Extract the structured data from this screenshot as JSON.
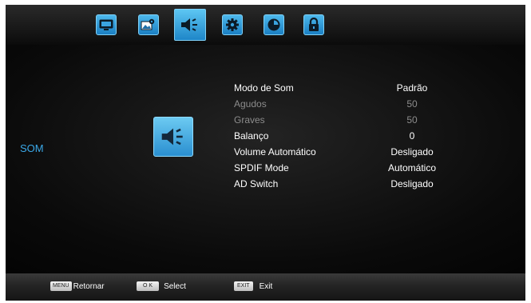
{
  "tabs": [
    {
      "icon": "tv-screen-icon",
      "active": false
    },
    {
      "icon": "picture-settings-icon",
      "active": false
    },
    {
      "icon": "speaker-icon",
      "active": true
    },
    {
      "icon": "gear-icon",
      "active": false
    },
    {
      "icon": "clock-icon",
      "active": false
    },
    {
      "icon": "lock-icon",
      "active": false
    }
  ],
  "section": {
    "title": "SOM",
    "icon": "speaker-icon"
  },
  "menu": {
    "items": [
      {
        "label": "Modo de Som",
        "value": "Padrão",
        "enabled": true
      },
      {
        "label": "Agudos",
        "value": "50",
        "enabled": false
      },
      {
        "label": "Graves",
        "value": "50",
        "enabled": false
      },
      {
        "label": "Balanço",
        "value": "0",
        "enabled": true
      },
      {
        "label": "Volume Automático",
        "value": "Desligado",
        "enabled": true
      },
      {
        "label": "SPDIF Mode",
        "value": "Automático",
        "enabled": true
      },
      {
        "label": "AD Switch",
        "value": "Desligado",
        "enabled": true
      }
    ]
  },
  "footer": {
    "hints": [
      {
        "key": "MENU",
        "text": "Retornar"
      },
      {
        "key": "O K",
        "text": "Select"
      },
      {
        "key": "EXIT",
        "text": "Exit"
      }
    ]
  },
  "colors": {
    "accent": "#2a9ee6",
    "section_label": "#3aa8e8",
    "text": "#ffffff",
    "disabled_text": "#8c8c8c",
    "background": "#070707"
  }
}
